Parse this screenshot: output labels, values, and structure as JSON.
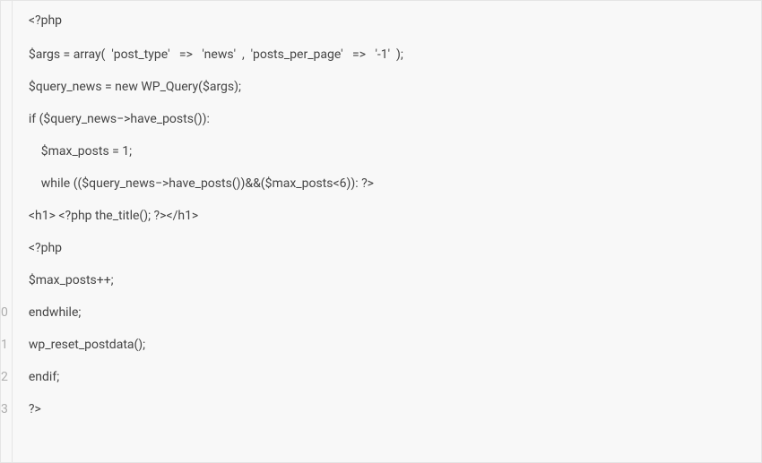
{
  "editor": {
    "lineNumbers": [
      "",
      "",
      "",
      "",
      "",
      "",
      "",
      "",
      "",
      "0",
      "1",
      "2",
      "3"
    ],
    "lines": [
      "<?php",
      "$args = array(  'post_type'   =>   'news'  ,  'posts_per_page'   =>   '-1'  );",
      "$query_news = new WP_Query($args);",
      "if ($query_news−>have_posts()):",
      "    $max_posts = 1;",
      "    while (($query_news−>have_posts())&&($max_posts<6)): ?>",
      "<h1> <?php the_title(); ?></h1>",
      "<?php",
      "$max_posts++;",
      "endwhile;",
      "wp_reset_postdata();",
      "endif;",
      "?>"
    ]
  }
}
